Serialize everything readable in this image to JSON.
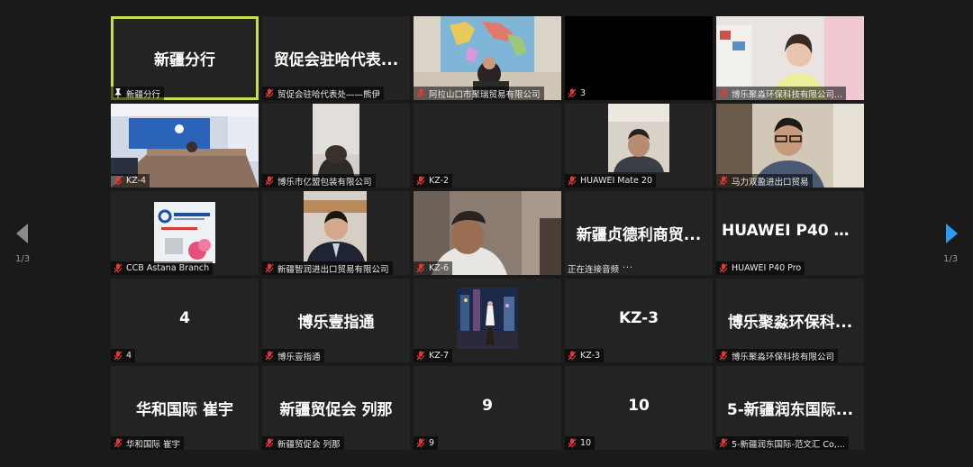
{
  "pagination": {
    "left": "1/3",
    "right": "1/3"
  },
  "colors": {
    "active_border": "#c4e04e",
    "mic_muted": "#e23a3a",
    "next_arrow": "#2e9bf0",
    "prev_arrow": "#8a8a8a"
  },
  "tiles": [
    {
      "name": "新疆分行",
      "label": "新疆分行",
      "kind": "name",
      "icon": "pin-icon",
      "active": true
    },
    {
      "name": "贸促会驻哈代表...",
      "label": "贸促会驻哈代表处——熊伊",
      "kind": "name",
      "icon": "mic-muted-icon"
    },
    {
      "label": "阿拉山口市聚瑞贸易有限公司",
      "kind": "video-map",
      "icon": "mic-muted-icon"
    },
    {
      "label": "3",
      "kind": "black",
      "icon": "mic-muted-icon"
    },
    {
      "label": "博乐聚淼环保科技有限公司...",
      "kind": "video-room",
      "icon": "mic-muted-icon"
    },
    {
      "label": "KZ-4",
      "kind": "video-conf",
      "icon": "mic-muted-icon"
    },
    {
      "label": "博乐市亿盟包装有限公司",
      "kind": "video-person",
      "icon": "mic-muted-icon"
    },
    {
      "label": "KZ-2",
      "kind": "empty",
      "icon": "mic-muted-icon"
    },
    {
      "label": "HUAWEI Mate 20",
      "kind": "video-person2",
      "icon": "mic-muted-icon"
    },
    {
      "label": "马力双盈进出口贸易",
      "kind": "video-man",
      "icon": "mic-muted-icon"
    },
    {
      "label": "CCB Astana Branch",
      "kind": "video-ccb",
      "icon": "mic-muted-icon"
    },
    {
      "label": "新疆智润进出口贸易有限公司",
      "kind": "video-suit",
      "icon": "mic-muted-icon"
    },
    {
      "label": "KZ-6",
      "kind": "video-kz6",
      "icon": "mic-muted-icon"
    },
    {
      "name": "新疆贞德利商贸...",
      "label": "正在连接音频",
      "kind": "connecting",
      "icon": "none",
      "dots": "···"
    },
    {
      "name": "HUAWEI P40 Pro",
      "label": "HUAWEI P40 Pro",
      "kind": "name",
      "icon": "mic-muted-icon"
    },
    {
      "name": "4",
      "label": "4",
      "kind": "name",
      "icon": "mic-muted-icon"
    },
    {
      "name": "博乐壹指通",
      "label": "博乐壹指通",
      "kind": "name",
      "icon": "mic-muted-icon"
    },
    {
      "label": "KZ-7",
      "kind": "video-night",
      "icon": "mic-muted-icon"
    },
    {
      "name": "KZ-3",
      "label": "KZ-3",
      "kind": "name",
      "icon": "mic-muted-icon"
    },
    {
      "name": "博乐聚淼环保科...",
      "label": "博乐聚淼环保科技有限公司",
      "kind": "name",
      "icon": "mic-muted-icon"
    },
    {
      "name": "华和国际 崔宇",
      "label": "华和国际 崔宇",
      "kind": "name",
      "icon": "mic-muted-icon"
    },
    {
      "name": "新疆贸促会 列那",
      "label": "新疆贸促会 列那",
      "kind": "name",
      "icon": "mic-muted-icon"
    },
    {
      "name": "9",
      "label": "9",
      "kind": "name",
      "icon": "mic-muted-icon"
    },
    {
      "name": "10",
      "label": "10",
      "kind": "name",
      "icon": "mic-muted-icon"
    },
    {
      "name": "5-新疆润东国际...",
      "label": "5-新疆润东国际-范文汇 Co,...",
      "kind": "name",
      "icon": "mic-muted-icon"
    }
  ]
}
